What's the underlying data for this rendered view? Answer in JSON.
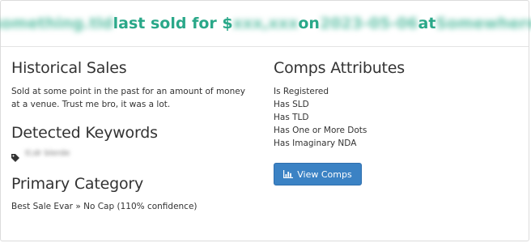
{
  "header": {
    "domain": "something.tld",
    "text_last_sold": "last sold for $",
    "price": "xxx,xxx",
    "text_on": "on",
    "date": "2023-05-06",
    "text_at": "at",
    "venue": "Somewhere"
  },
  "historical_sales": {
    "title": "Historical Sales",
    "description": "Sold at some point in the past for an amount of money at a venue. Trust me bro, it was a lot."
  },
  "detected_keywords": {
    "title": "Detected Keywords",
    "keyword": "tl;dr blerde"
  },
  "primary_category": {
    "title": "Primary Category",
    "value": "Best Sale Evar » No Cap (110% confidence)"
  },
  "comps_attributes": {
    "title": "Comps Attributes",
    "items": [
      "Is Registered",
      "Has SLD",
      "Has TLD",
      "Has One or More Dots",
      "Has Imaginary NDA"
    ]
  },
  "view_comps_button": {
    "label": "View Comps"
  },
  "colors": {
    "accent": "#2aa889",
    "button": "#3b82c4"
  },
  "icons": {
    "keyword": "tag-icon",
    "button": "bar-chart-icon"
  }
}
